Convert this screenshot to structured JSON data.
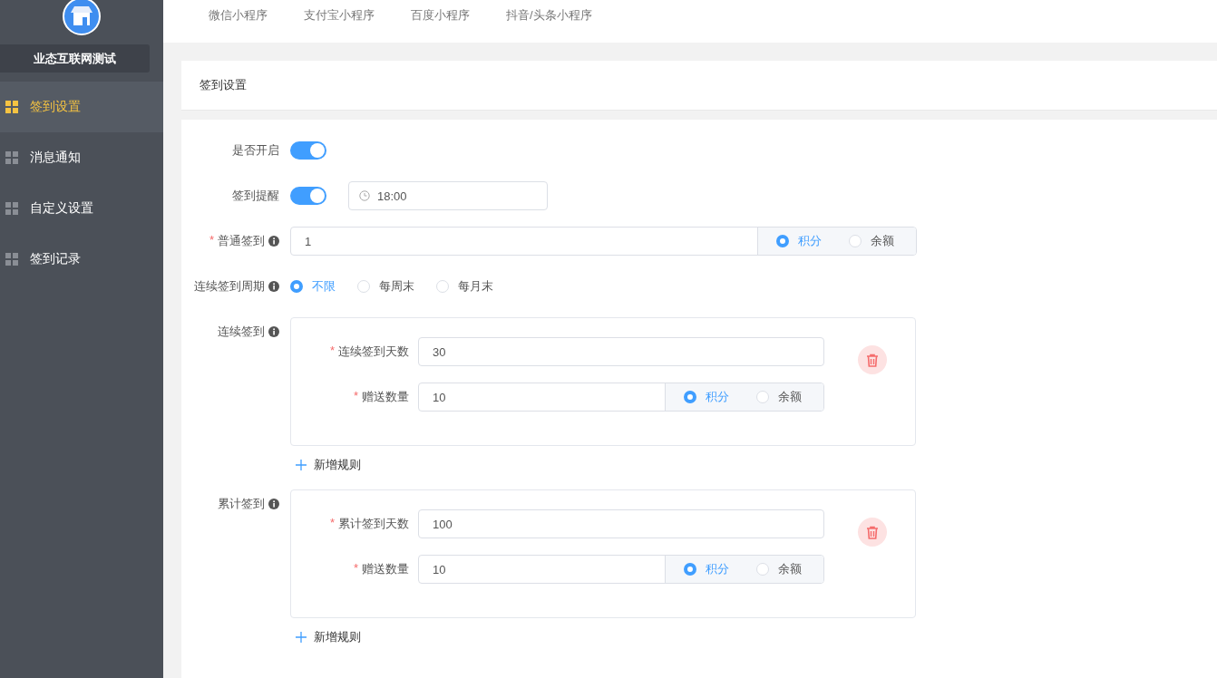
{
  "sidebar": {
    "store_name": "业态互联网测试",
    "items": [
      {
        "label": "签到设置",
        "selected": true
      },
      {
        "label": "消息通知",
        "selected": false
      },
      {
        "label": "自定义设置",
        "selected": false
      },
      {
        "label": "签到记录",
        "selected": false
      }
    ]
  },
  "tabs": [
    {
      "label": "微信小程序"
    },
    {
      "label": "支付宝小程序"
    },
    {
      "label": "百度小程序"
    },
    {
      "label": "抖音/头条小程序"
    }
  ],
  "card": {
    "title": "签到设置"
  },
  "form": [
    {
      "kind": "switch",
      "label": "是否开启",
      "info": false,
      "on": true
    },
    {
      "kind": "time_switch",
      "label": "签到提醒",
      "info": false,
      "on": true,
      "time": "18:00"
    },
    {
      "kind": "amount",
      "star": "*",
      "label": "普通签到",
      "info": true,
      "value": "1",
      "options": [
        {
          "label": "积分",
          "selected": true
        },
        {
          "label": "余额",
          "selected": false
        }
      ]
    },
    {
      "kind": "radio",
      "label": "连续签到周期",
      "info": true,
      "options": [
        {
          "label": "不限",
          "selected": true
        },
        {
          "label": "每周末",
          "selected": false
        },
        {
          "label": "每月末",
          "selected": false
        }
      ]
    },
    {
      "kind": "rules",
      "label": "连续签到",
      "info": true,
      "add_label": "新增规则",
      "rules": [
        {
          "days_star": "*",
          "days_label": "连续签到天数",
          "days": "30",
          "amount_star": "*",
          "amount_label": "赠送数量",
          "amount": "10",
          "options": [
            {
              "label": "积分",
              "selected": true
            },
            {
              "label": "余额",
              "selected": false
            }
          ]
        }
      ]
    },
    {
      "kind": "rules",
      "label": "累计签到",
      "info": true,
      "add_label": "新增规则",
      "rules": [
        {
          "days_star": "*",
          "days_label": "累计签到天数",
          "days": "100",
          "amount_star": "*",
          "amount_label": "赠送数量",
          "amount": "10",
          "options": [
            {
              "label": "积分",
              "selected": true
            },
            {
              "label": "余额",
              "selected": false
            }
          ]
        }
      ]
    }
  ]
}
